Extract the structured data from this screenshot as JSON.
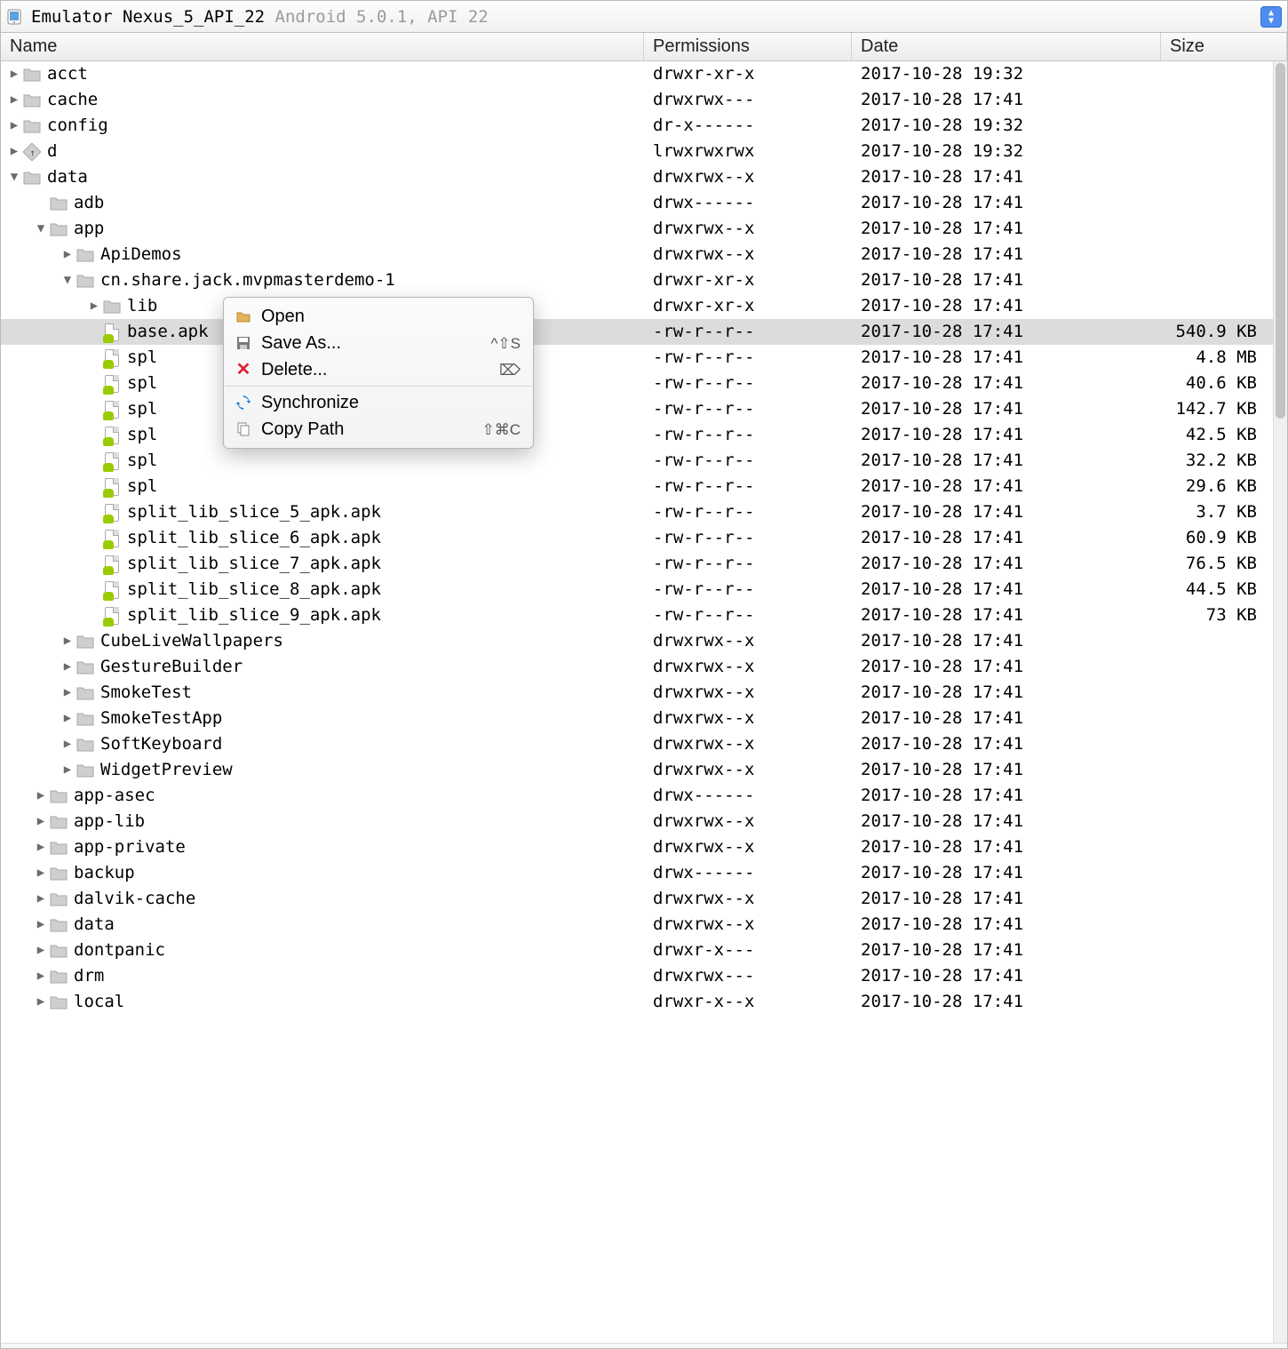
{
  "breadcrumb": {
    "prefix": "Emulator ",
    "device": "Nexus_5_API_22",
    "suffix": " Android 5.0.1, API 22"
  },
  "columns": {
    "name": "Name",
    "perm": "Permissions",
    "date": "Date",
    "size": "Size"
  },
  "context_menu": {
    "open": "Open",
    "save_as": "Save As...",
    "save_as_sc": "^⇧S",
    "delete": "Delete...",
    "delete_sc": "⌦",
    "sync": "Synchronize",
    "copy_path": "Copy Path",
    "copy_path_sc": "⇧⌘C"
  },
  "rows": [
    {
      "depth": 0,
      "chev": "r",
      "icon": "folder",
      "name": "acct",
      "perm": "drwxr-xr-x",
      "date": "2017-10-28 19:32",
      "size": ""
    },
    {
      "depth": 0,
      "chev": "r",
      "icon": "folder",
      "name": "cache",
      "perm": "drwxrwx---",
      "date": "2017-10-28 17:41",
      "size": ""
    },
    {
      "depth": 0,
      "chev": "r",
      "icon": "folder",
      "name": "config",
      "perm": "dr-x------",
      "date": "2017-10-28 19:32",
      "size": ""
    },
    {
      "depth": 0,
      "chev": "r",
      "icon": "link",
      "name": "d",
      "perm": "lrwxrwxrwx",
      "date": "2017-10-28 19:32",
      "size": ""
    },
    {
      "depth": 0,
      "chev": "d",
      "icon": "folder",
      "name": "data",
      "perm": "drwxrwx--x",
      "date": "2017-10-28 17:41",
      "size": ""
    },
    {
      "depth": 1,
      "chev": "n",
      "icon": "folder",
      "name": "adb",
      "perm": "drwx------",
      "date": "2017-10-28 17:41",
      "size": ""
    },
    {
      "depth": 1,
      "chev": "d",
      "icon": "folder",
      "name": "app",
      "perm": "drwxrwx--x",
      "date": "2017-10-28 17:41",
      "size": ""
    },
    {
      "depth": 2,
      "chev": "r",
      "icon": "folder",
      "name": "ApiDemos",
      "perm": "drwxrwx--x",
      "date": "2017-10-28 17:41",
      "size": ""
    },
    {
      "depth": 2,
      "chev": "d",
      "icon": "folder",
      "name": "cn.share.jack.mvpmasterdemo-1",
      "perm": "drwxr-xr-x",
      "date": "2017-10-28 17:41",
      "size": ""
    },
    {
      "depth": 3,
      "chev": "r",
      "icon": "folder",
      "name": "lib",
      "perm": "drwxr-xr-x",
      "date": "2017-10-28 17:41",
      "size": ""
    },
    {
      "depth": 3,
      "chev": "n",
      "icon": "apk",
      "name": "base.apk",
      "perm": "-rw-r--r--",
      "date": "2017-10-28 17:41",
      "size": "540.9 KB",
      "selected": true
    },
    {
      "depth": 3,
      "chev": "n",
      "icon": "apk",
      "name": "split_lib_dependencies_apk.apk",
      "perm": "-rw-r--r--",
      "date": "2017-10-28 17:41",
      "size": "4.8 MB",
      "obscured": true,
      "vis": "spl"
    },
    {
      "depth": 3,
      "chev": "n",
      "icon": "apk",
      "name": "split_lib_slice_0_apk.apk",
      "perm": "-rw-r--r--",
      "date": "2017-10-28 17:41",
      "size": "40.6 KB",
      "obscured": true,
      "vis": "spl"
    },
    {
      "depth": 3,
      "chev": "n",
      "icon": "apk",
      "name": "split_lib_slice_1_apk.apk",
      "perm": "-rw-r--r--",
      "date": "2017-10-28 17:41",
      "size": "142.7 KB",
      "obscured": true,
      "vis": "spl"
    },
    {
      "depth": 3,
      "chev": "n",
      "icon": "apk",
      "name": "split_lib_slice_2_apk.apk",
      "perm": "-rw-r--r--",
      "date": "2017-10-28 17:41",
      "size": "42.5 KB",
      "obscured": true,
      "vis": "spl"
    },
    {
      "depth": 3,
      "chev": "n",
      "icon": "apk",
      "name": "split_lib_slice_3_apk.apk",
      "perm": "-rw-r--r--",
      "date": "2017-10-28 17:41",
      "size": "32.2 KB",
      "obscured": true,
      "vis": "spl"
    },
    {
      "depth": 3,
      "chev": "n",
      "icon": "apk",
      "name": "split_lib_slice_4_apk.apk",
      "perm": "-rw-r--r--",
      "date": "2017-10-28 17:41",
      "size": "29.6 KB",
      "obscured": true,
      "vis": "spl"
    },
    {
      "depth": 3,
      "chev": "n",
      "icon": "apk",
      "name": "split_lib_slice_5_apk.apk",
      "perm": "-rw-r--r--",
      "date": "2017-10-28 17:41",
      "size": "3.7 KB"
    },
    {
      "depth": 3,
      "chev": "n",
      "icon": "apk",
      "name": "split_lib_slice_6_apk.apk",
      "perm": "-rw-r--r--",
      "date": "2017-10-28 17:41",
      "size": "60.9 KB"
    },
    {
      "depth": 3,
      "chev": "n",
      "icon": "apk",
      "name": "split_lib_slice_7_apk.apk",
      "perm": "-rw-r--r--",
      "date": "2017-10-28 17:41",
      "size": "76.5 KB"
    },
    {
      "depth": 3,
      "chev": "n",
      "icon": "apk",
      "name": "split_lib_slice_8_apk.apk",
      "perm": "-rw-r--r--",
      "date": "2017-10-28 17:41",
      "size": "44.5 KB"
    },
    {
      "depth": 3,
      "chev": "n",
      "icon": "apk",
      "name": "split_lib_slice_9_apk.apk",
      "perm": "-rw-r--r--",
      "date": "2017-10-28 17:41",
      "size": "73 KB"
    },
    {
      "depth": 2,
      "chev": "r",
      "icon": "folder",
      "name": "CubeLiveWallpapers",
      "perm": "drwxrwx--x",
      "date": "2017-10-28 17:41",
      "size": ""
    },
    {
      "depth": 2,
      "chev": "r",
      "icon": "folder",
      "name": "GestureBuilder",
      "perm": "drwxrwx--x",
      "date": "2017-10-28 17:41",
      "size": ""
    },
    {
      "depth": 2,
      "chev": "r",
      "icon": "folder",
      "name": "SmokeTest",
      "perm": "drwxrwx--x",
      "date": "2017-10-28 17:41",
      "size": ""
    },
    {
      "depth": 2,
      "chev": "r",
      "icon": "folder",
      "name": "SmokeTestApp",
      "perm": "drwxrwx--x",
      "date": "2017-10-28 17:41",
      "size": ""
    },
    {
      "depth": 2,
      "chev": "r",
      "icon": "folder",
      "name": "SoftKeyboard",
      "perm": "drwxrwx--x",
      "date": "2017-10-28 17:41",
      "size": ""
    },
    {
      "depth": 2,
      "chev": "r",
      "icon": "folder",
      "name": "WidgetPreview",
      "perm": "drwxrwx--x",
      "date": "2017-10-28 17:41",
      "size": ""
    },
    {
      "depth": 1,
      "chev": "r",
      "icon": "folder",
      "name": "app-asec",
      "perm": "drwx------",
      "date": "2017-10-28 17:41",
      "size": ""
    },
    {
      "depth": 1,
      "chev": "r",
      "icon": "folder",
      "name": "app-lib",
      "perm": "drwxrwx--x",
      "date": "2017-10-28 17:41",
      "size": ""
    },
    {
      "depth": 1,
      "chev": "r",
      "icon": "folder",
      "name": "app-private",
      "perm": "drwxrwx--x",
      "date": "2017-10-28 17:41",
      "size": ""
    },
    {
      "depth": 1,
      "chev": "r",
      "icon": "folder",
      "name": "backup",
      "perm": "drwx------",
      "date": "2017-10-28 17:41",
      "size": ""
    },
    {
      "depth": 1,
      "chev": "r",
      "icon": "folder",
      "name": "dalvik-cache",
      "perm": "drwxrwx--x",
      "date": "2017-10-28 17:41",
      "size": ""
    },
    {
      "depth": 1,
      "chev": "r",
      "icon": "folder",
      "name": "data",
      "perm": "drwxrwx--x",
      "date": "2017-10-28 17:41",
      "size": ""
    },
    {
      "depth": 1,
      "chev": "r",
      "icon": "folder",
      "name": "dontpanic",
      "perm": "drwxr-x---",
      "date": "2017-10-28 17:41",
      "size": ""
    },
    {
      "depth": 1,
      "chev": "r",
      "icon": "folder",
      "name": "drm",
      "perm": "drwxrwx---",
      "date": "2017-10-28 17:41",
      "size": ""
    },
    {
      "depth": 1,
      "chev": "r",
      "icon": "folder",
      "name": "local",
      "perm": "drwxr-x--x",
      "date": "2017-10-28 17:41",
      "size": ""
    }
  ]
}
